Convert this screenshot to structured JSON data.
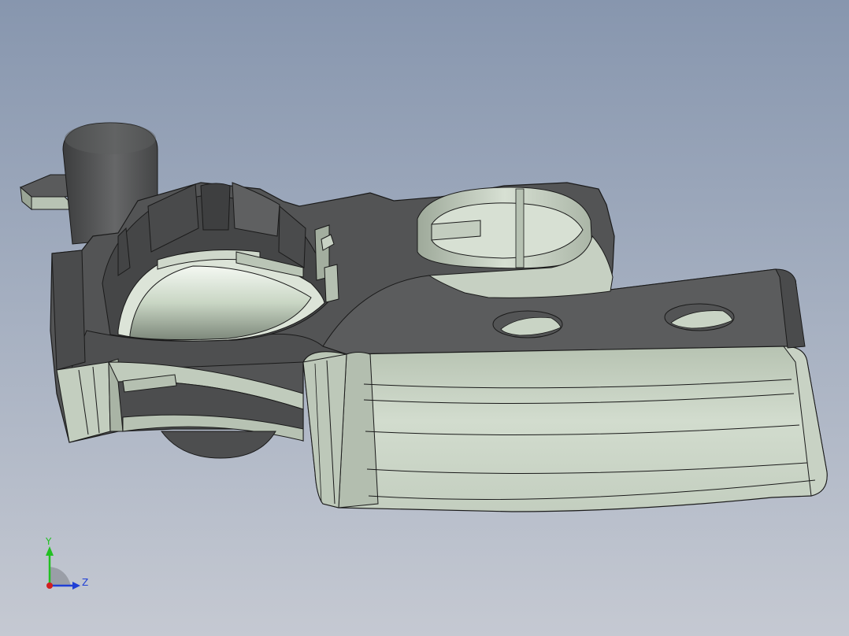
{
  "viewport": {
    "background_top": "#8796ae",
    "background_bottom": "#c5c9d2",
    "model_dark_face": "#535455",
    "model_light_face": "#c9d6c4",
    "edge_color": "#1a1a1a"
  },
  "triad": {
    "y_label": "Y",
    "z_label": "Z",
    "y_color": "#22c022",
    "z_color": "#1f3fd6",
    "x_color": "#d21f1f"
  }
}
